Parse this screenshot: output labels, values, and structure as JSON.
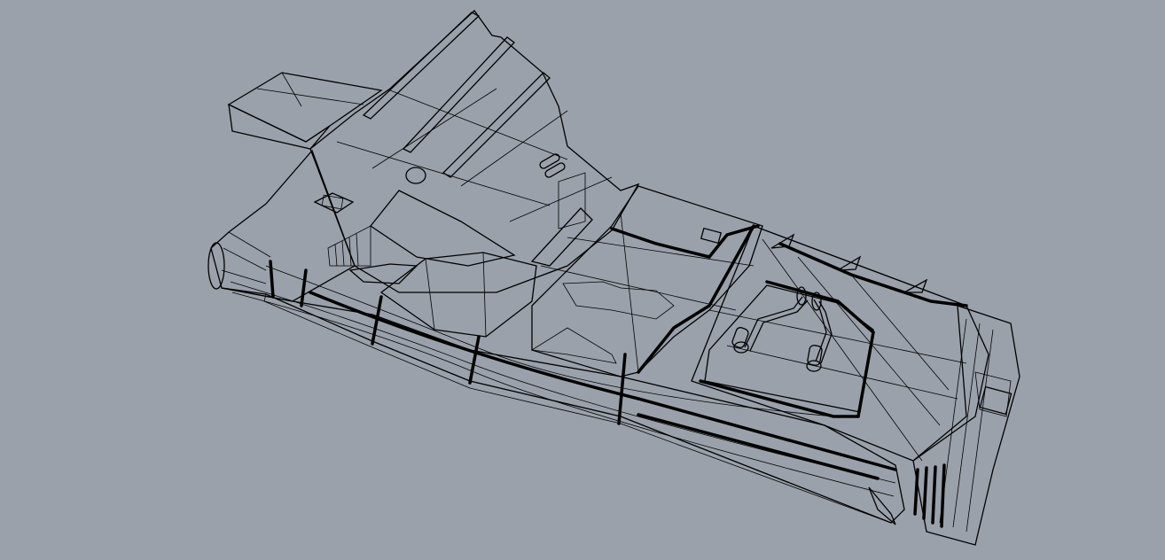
{
  "viewport": {
    "background": "#9aa1ab",
    "model_fill_light": "#e3e3e3",
    "model_fill_mid": "#cfcfcf",
    "model_fill_dark": "#b8b8b8",
    "cutout_fill": "#a4abb5",
    "edge_color": "#000000"
  }
}
